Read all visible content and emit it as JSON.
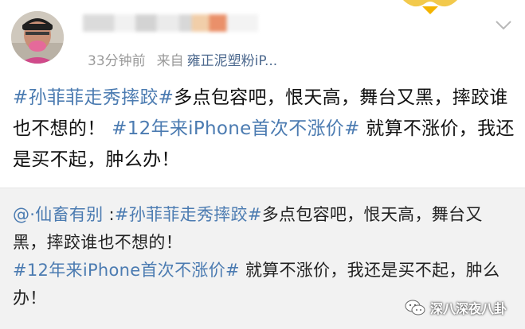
{
  "post": {
    "time": "33分钟前",
    "source_prefix": "来自",
    "source_name": "雍正泥塑粉iP...",
    "text": {
      "tag1": "#孙菲菲走秀摔跤#",
      "body1": "多点包容吧，恨天高，舞台又黑，摔跤谁也不想的！ ",
      "tag2": "#12年来iPhone首次不涨价#",
      "body2": " 就算不涨价，我还是买不起，肿么办！"
    }
  },
  "repost": {
    "user": "@·仙畜有别",
    "colon": " :",
    "tag1": "#孙菲菲走秀摔跤#",
    "body1": "多点包容吧，恨天高，舞台又黑，摔跤谁也不想的！",
    "tag2": "#12年来iPhone首次不涨价#",
    "body2": " 就算不涨价，我还是买不起，肿么办！"
  },
  "watermark": {
    "text": "深八深夜八卦"
  },
  "icons": {
    "expand": "chevron-down-icon",
    "watermark": "wechat-icon"
  },
  "colors": {
    "link": "#4b7bb1",
    "meta": "#9a9a9a",
    "source": "#4e6a8f",
    "repost_bg": "#f2f2f2"
  }
}
